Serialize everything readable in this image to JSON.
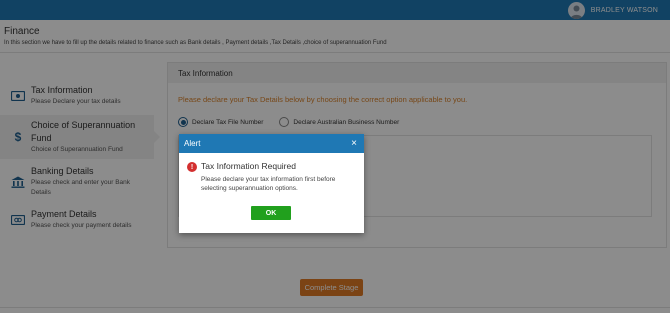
{
  "header": {
    "user_name": "BRADLEY WATSON",
    "avatar_icon": "user-avatar-icon",
    "bar_color": "#1f78b4"
  },
  "page": {
    "title": "Finance",
    "description": "In this section we have to fill up the details related to finance such as Bank details , Payment details ,Tax Details ,choice of superannuation Fund"
  },
  "sidebar": {
    "items": [
      {
        "title": "Tax Information",
        "subtitle": "Please Declare your tax details",
        "icon": "money-icon",
        "active": false
      },
      {
        "title": "Choice of Superannuation Fund",
        "subtitle": "Choice of Superannuation Fund",
        "icon": "dollar-icon",
        "active": true
      },
      {
        "title": "Banking Details",
        "subtitle": "Please check and enter your Bank Details",
        "icon": "bank-icon",
        "active": false
      },
      {
        "title": "Payment Details",
        "subtitle": "Please check your payment details",
        "icon": "payment-card-icon",
        "active": false
      }
    ]
  },
  "main": {
    "section_title": "Tax Information",
    "hint": "Please declare your Tax Details below by choosing the correct option applicable to you.",
    "options": [
      {
        "label": "Declare Tax File Number",
        "selected": true
      },
      {
        "label": "Declare Australian Business Number",
        "selected": false
      }
    ],
    "complete_button": "Complete Stage",
    "accent_color": "#e07b26"
  },
  "modal": {
    "header": "Alert",
    "close_symbol": "×",
    "error_symbol": "!",
    "title": "Tax Information Required",
    "message": "Please declare your tax information first before selecting superannuation options.",
    "ok_label": "OK",
    "ok_color": "#21a01d"
  }
}
